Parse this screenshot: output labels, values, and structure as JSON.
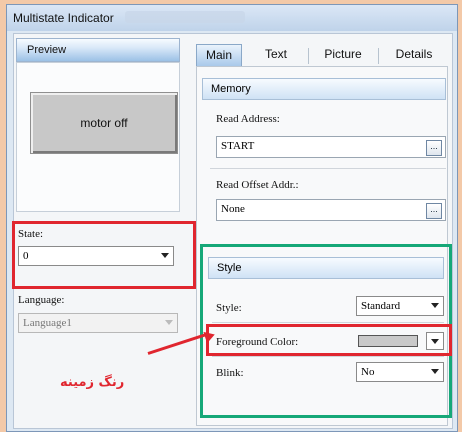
{
  "window": {
    "title": "Multistate Indicator"
  },
  "preview": {
    "header": "Preview",
    "display_text": "motor off",
    "state_label": "State:",
    "state_value": "0",
    "language_label": "Language:",
    "language_value": "Language1"
  },
  "tabs": [
    "Main",
    "Text",
    "Picture",
    "Details"
  ],
  "memory": {
    "header": "Memory",
    "read_address_label": "Read Address:",
    "read_address_value": "START",
    "read_offset_label": "Read Offset Addr.:",
    "read_offset_value": "None",
    "browse_label": "..."
  },
  "style": {
    "header": "Style",
    "style_label": "Style:",
    "style_value": "Standard",
    "foreground_label": "Foreground Color:",
    "foreground_color": "#c9c9c9",
    "blink_label": "Blink:",
    "blink_value": "No"
  },
  "annotation": {
    "text": "رنگ زمینه"
  },
  "colors": {
    "highlight_red": "#e0262f",
    "highlight_green": "#16a878"
  }
}
